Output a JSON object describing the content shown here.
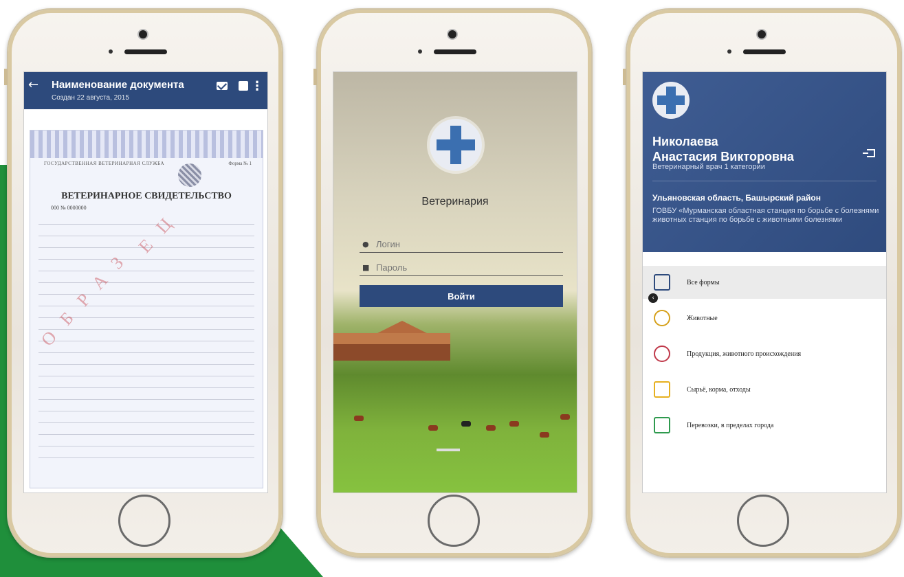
{
  "phone1": {
    "header": {
      "back_glyph": "←",
      "title": "Наименование документа",
      "subtitle": "Создан 22 августа, 2015",
      "more_glyph": "⋮"
    },
    "certificate": {
      "org": "ГОСУДАРСТВЕННАЯ ВЕТЕРИНАРНАЯ СЛУЖБА",
      "form": "Форма № 1",
      "title": "ВЕТЕРИНАРНОЕ СВИДЕТЕЛЬСТВО",
      "number": "000 № 0000000",
      "watermark_a": "ОБРАЗ",
      "watermark_b": "ЕЦ"
    }
  },
  "phone2": {
    "app_title": "Ветеринария",
    "login_placeholder": "Логин",
    "password_placeholder": "Пароль",
    "login_button": "Войти"
  },
  "phone3": {
    "profile": {
      "name_line1": "Николаева",
      "name_line2": "Анастасия Викторовна",
      "role": "Ветеринарный врач 1 категории",
      "region": "Ульяновская область, Башырский район",
      "organization": "ГОВБУ «Мурманская областная станция по борьбе с болезнями животных  станция по борьбе с животными болезнями"
    },
    "menu": [
      {
        "label": "Все формы",
        "icon": "forms-icon",
        "color": "#2d4a7c",
        "active": true
      },
      {
        "label": "Животные",
        "icon": "cow-icon",
        "color": "#d6a11c",
        "active": false
      },
      {
        "label": "Продукция, животного происхождения",
        "icon": "meat-icon",
        "color": "#c0394a",
        "active": false
      },
      {
        "label": "Сырьё, корма, отходы",
        "icon": "sack-icon",
        "color": "#e6b020",
        "active": false
      },
      {
        "label": "Перевозки, в пределах города",
        "icon": "map-icon",
        "color": "#2e9a4e",
        "active": false
      }
    ],
    "collapse_glyph": "‹"
  },
  "colors": {
    "brand_blue": "#2d4a7c",
    "background_green": "#1f8f3b"
  }
}
